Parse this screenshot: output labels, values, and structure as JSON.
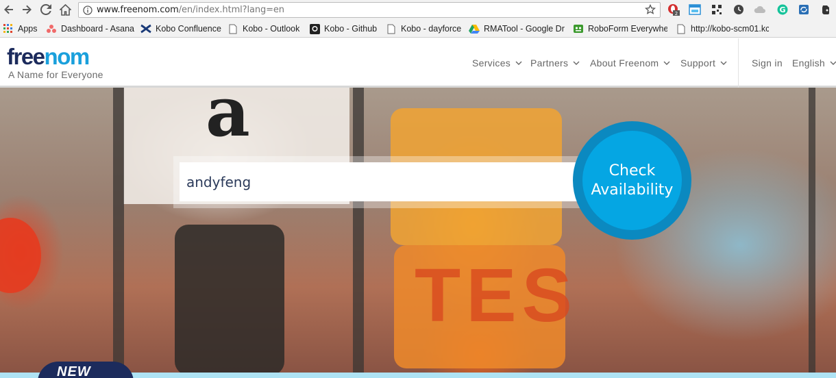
{
  "browser": {
    "url_main": "www.freenom.com",
    "url_path": "/en/index.html?lang=en",
    "ext_badge": "2"
  },
  "bookmarks": [
    {
      "label": "Apps",
      "icon": "apps-grid-icon"
    },
    {
      "label": "Dashboard - Asana",
      "icon": "asana-icon"
    },
    {
      "label": "Kobo Confluence",
      "icon": "confluence-icon"
    },
    {
      "label": "Kobo - Outlook",
      "icon": "page-icon"
    },
    {
      "label": "Kobo - Github",
      "icon": "github-icon"
    },
    {
      "label": "Kobo - dayforce",
      "icon": "page-icon"
    },
    {
      "label": "RMATool - Google Dr",
      "icon": "google-drive-icon"
    },
    {
      "label": "RoboForm Everywher",
      "icon": "roboform-icon"
    },
    {
      "label": "http://kobo-scm01.kc",
      "icon": "page-icon"
    }
  ],
  "site": {
    "logo_part1": "free",
    "logo_part2": "nom",
    "tagline": "A Name for Everyone",
    "menu": {
      "services": "Services",
      "partners": "Partners",
      "about": "About Freenom",
      "support": "Support",
      "signin": "Sign in",
      "language": "English"
    }
  },
  "hero": {
    "search_value": "andyfeng",
    "check_label_line1": "Check",
    "check_label_line2": "Availability",
    "bg_letter": "a",
    "bg_sign_text": "TES",
    "badge_text": "NEW"
  },
  "colors": {
    "brand_dark": "#1c2b5c",
    "brand_blue": "#1aa0dc",
    "button_blue": "#05a6e3"
  }
}
